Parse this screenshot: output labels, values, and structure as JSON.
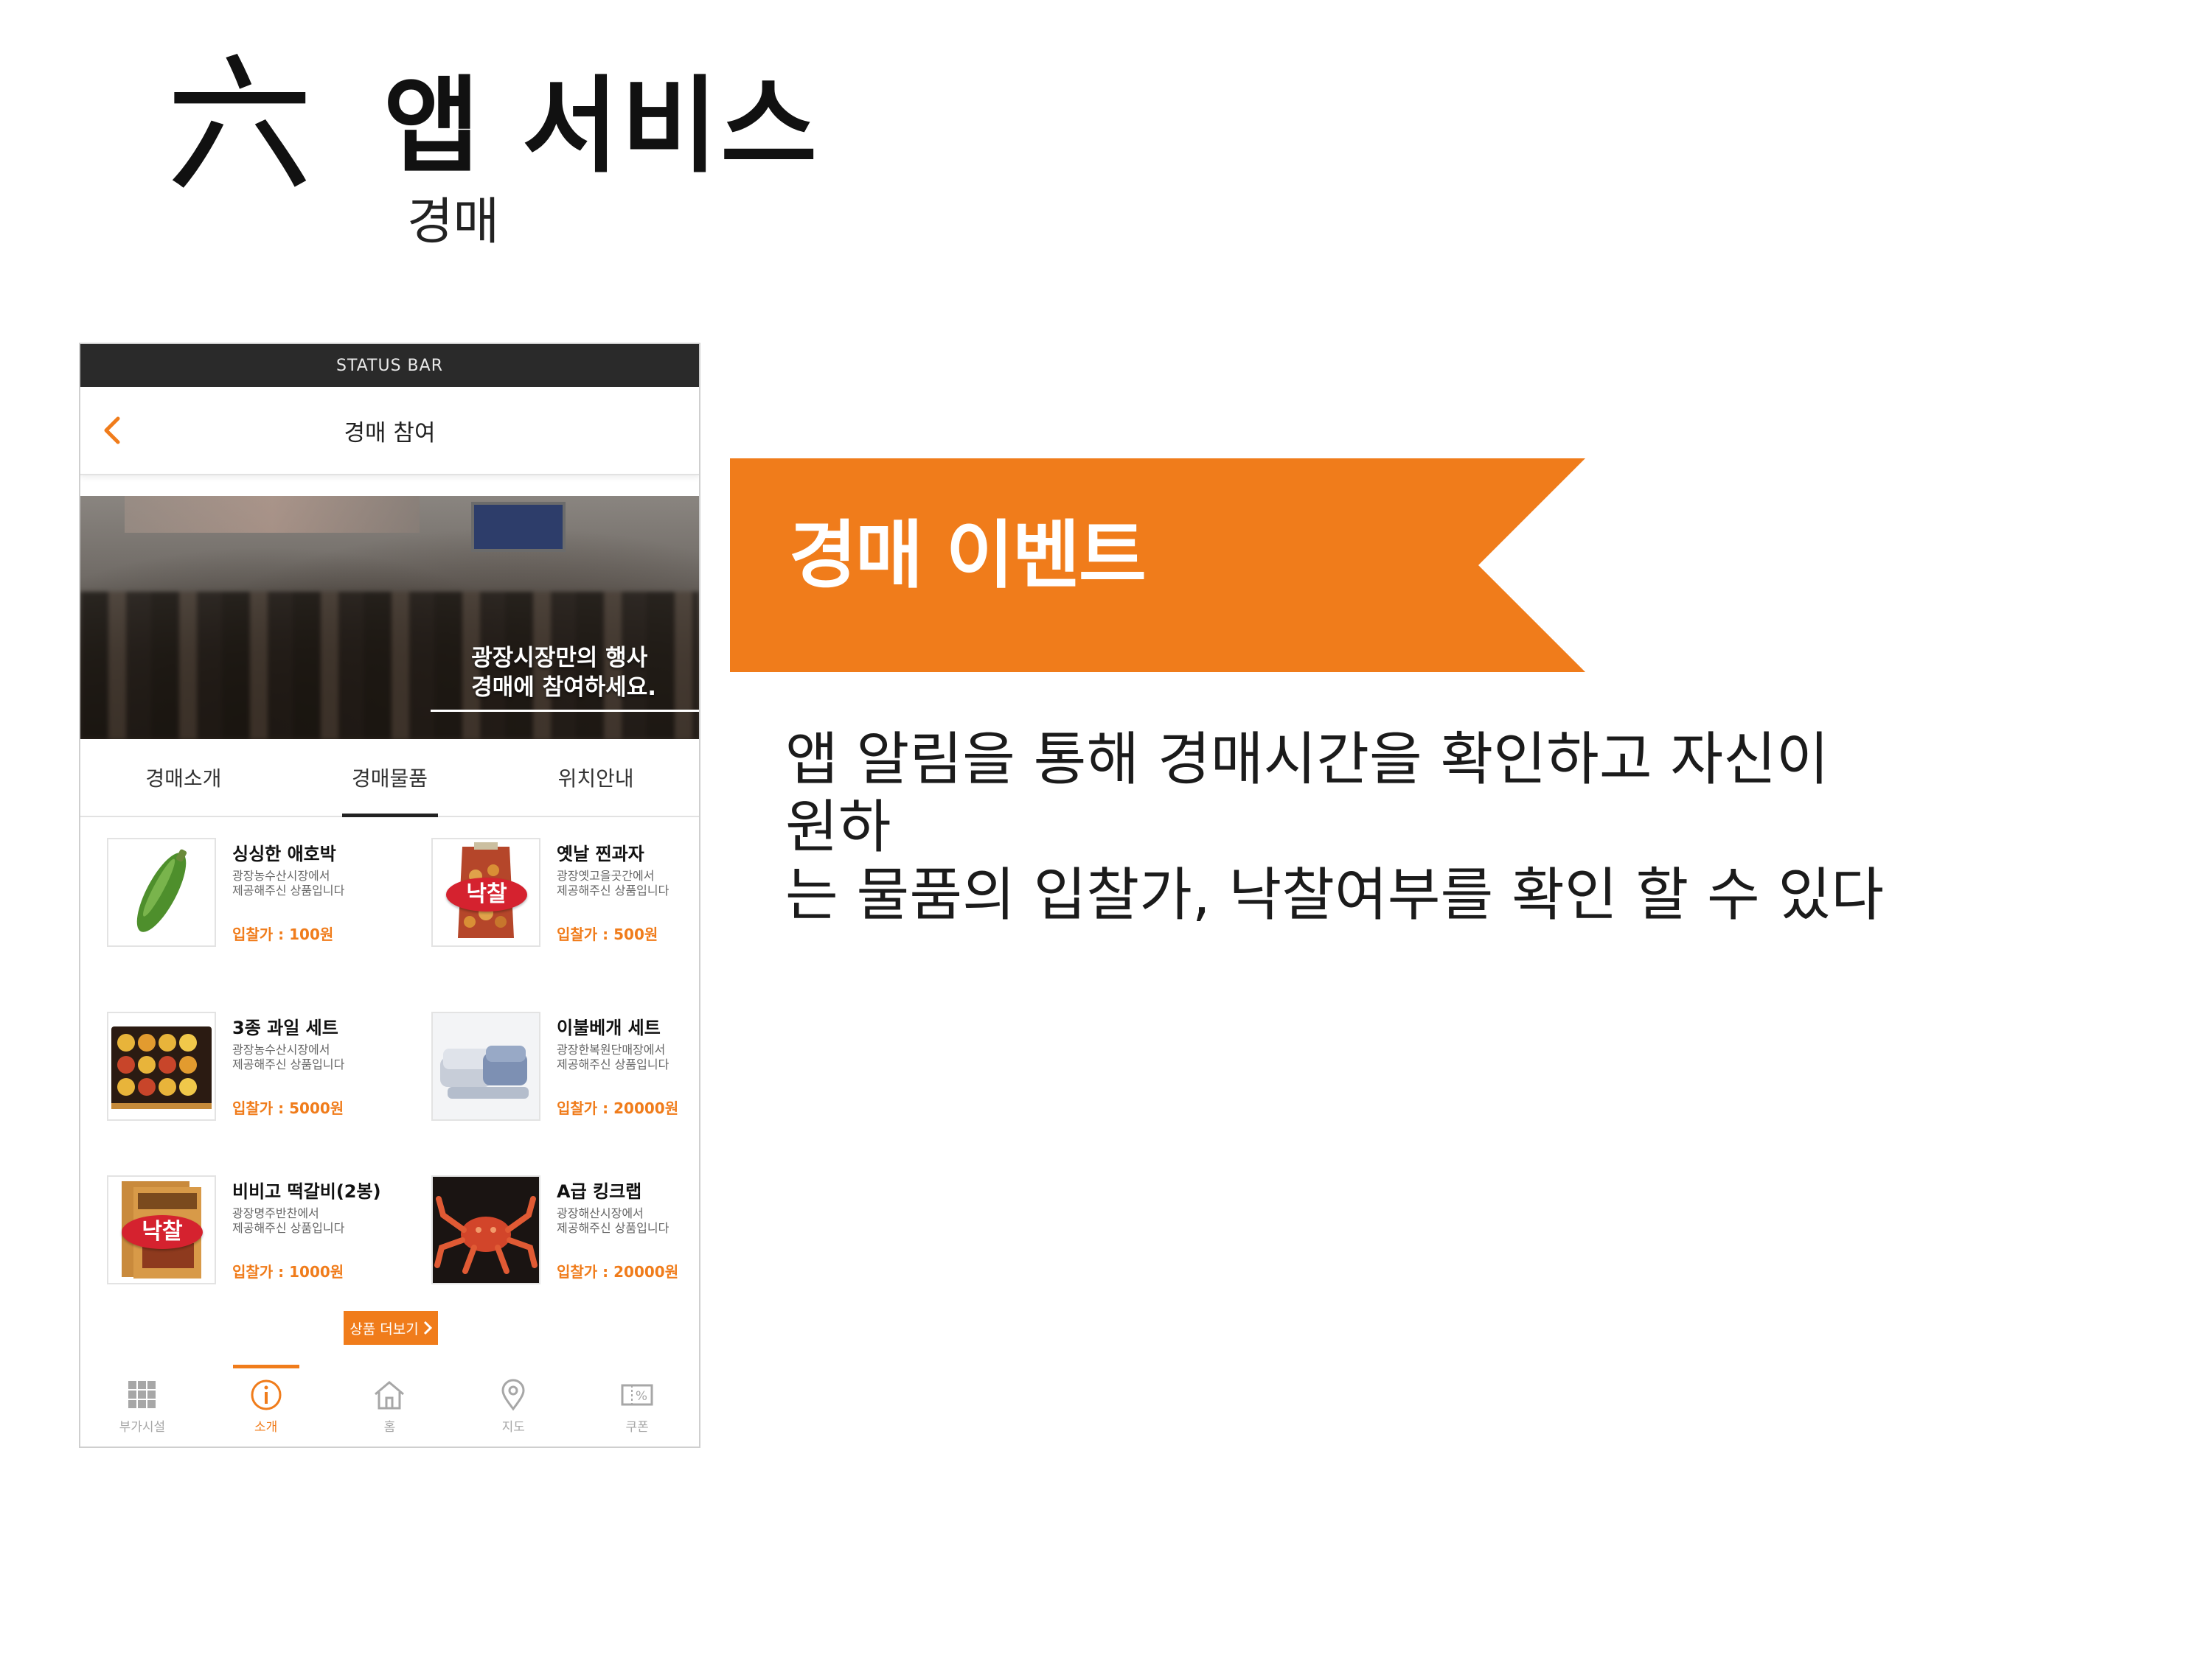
{
  "slide": {
    "numeral": "六",
    "title": "앱 서비스",
    "subtitle": "경매"
  },
  "phone": {
    "status_bar": "STATUS BAR",
    "header_title": "경매 참여",
    "banner": {
      "line1": "광장시장만의 행사",
      "line2": "경매에 참여하세요."
    },
    "tabs": [
      {
        "label": "경매소개",
        "active": false
      },
      {
        "label": "경매물품",
        "active": true
      },
      {
        "label": "위치안내",
        "active": false
      }
    ],
    "products": [
      {
        "name": "싱싱한 애호박",
        "desc1": "광장농수산시장에서",
        "desc2": "제공해주신 상품입니다",
        "price": "입찰가 : 100원",
        "sold": false
      },
      {
        "name": "옛날 찐과자",
        "desc1": "광장옛고을곳간에서",
        "desc2": "제공해주신 상품입니다",
        "price": "입찰가 : 500원",
        "sold": true
      },
      {
        "name": "3종 과일 세트",
        "desc1": "광장농수산시장에서",
        "desc2": "제공해주신 상품입니다",
        "price": "입찰가 : 5000원",
        "sold": false
      },
      {
        "name": "이불베개 세트",
        "desc1": "광장한복원단매장에서",
        "desc2": "제공해주신 상품입니다",
        "price": "입찰가 : 20000원",
        "sold": false
      },
      {
        "name": "비비고 떡갈비(2봉)",
        "desc1": "광장명주반찬에서",
        "desc2": "제공해주신 상품입니다",
        "price": "입찰가 : 1000원",
        "sold": true
      },
      {
        "name": "A급 킹크랩",
        "desc1": "광장해산시장에서",
        "desc2": "제공해주신 상품입니다",
        "price": "입찰가 : 20000원",
        "sold": false
      }
    ],
    "sold_badge": "낙찰",
    "more_button": "상품 더보기",
    "nav": [
      {
        "label": "부가시설",
        "icon": "grid-icon",
        "active": false
      },
      {
        "label": "소개",
        "icon": "info-icon",
        "active": true
      },
      {
        "label": "홈",
        "icon": "home-icon",
        "active": false
      },
      {
        "label": "지도",
        "icon": "map-pin-icon",
        "active": false
      },
      {
        "label": "쿠폰",
        "icon": "coupon-icon",
        "active": false
      }
    ]
  },
  "ribbon": {
    "label": "경매 이벤트",
    "color": "#f07c1b"
  },
  "description": {
    "line1": "앱 알림을 통해 경매시간을 확인하고 자신이 원하",
    "line2": "는 물품의 입찰가, 낙찰여부를 확인 할 수 있다"
  },
  "colors": {
    "accent": "#f07c1b",
    "status_bar": "#2a2a2a",
    "sold_badge": "#d5222f"
  }
}
